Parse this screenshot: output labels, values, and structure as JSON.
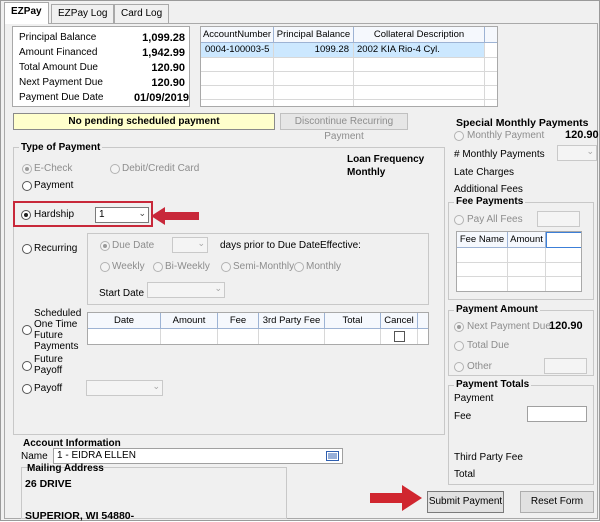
{
  "tabs": [
    {
      "label": "EZPay",
      "active": true
    },
    {
      "label": "EZPay Log",
      "active": false
    },
    {
      "label": "Card Log",
      "active": false
    }
  ],
  "summary": {
    "principal_balance_label": "Principal Balance",
    "principal_balance": "1,099.28",
    "amount_financed_label": "Amount Financed",
    "amount_financed": "1,942.99",
    "total_amount_due_label": "Total Amount Due",
    "total_amount_due": "120.90",
    "next_payment_due_label": "Next Payment Due",
    "next_payment_due": "120.90",
    "payment_due_date_label": "Payment Due Date",
    "payment_due_date": "01/09/2019"
  },
  "accounts_grid": {
    "headers": [
      "AccountNumber",
      "Principal Balance",
      "Collateral Description"
    ],
    "rows": [
      [
        "0004-100003-5",
        "1099.28",
        "2002 KIA Rio-4 Cyl."
      ]
    ]
  },
  "banner": "No pending scheduled payment",
  "discontinue_button": "Discontinue Recurring Payment",
  "type_of_payment": {
    "title": "Type of Payment",
    "echeck": "E-Check",
    "debit_credit": "Debit/Credit Card",
    "payment": "Payment",
    "hardship": "Hardship",
    "hardship_value": "1",
    "recurring": "Recurring",
    "scheduled": [
      "Scheduled",
      "One Time",
      "Future",
      "Payments"
    ],
    "future_payoff": [
      "Future",
      "Payoff"
    ],
    "payoff": "Payoff"
  },
  "loan_frequency": {
    "label": "Loan Frequency",
    "value": "Monthly"
  },
  "recurring": {
    "due_date": "Due Date",
    "days_prior": "days prior to Due Date",
    "effective": "Effective:",
    "weekly": "Weekly",
    "biweekly": "Bi-Weekly",
    "semimonthly": "Semi-Monthly",
    "monthly": "Monthly",
    "start_date": "Start Date"
  },
  "scheduled_grid": {
    "headers": [
      "Date",
      "Amount",
      "Fee",
      "3rd Party Fee",
      "Total",
      "Cancel"
    ]
  },
  "special_monthly": {
    "title": "Special Monthly Payments",
    "monthly_payment": "Monthly Payment",
    "monthly_payment_value": "120.90",
    "num_monthly": "# Monthly Payments",
    "late_charges": "Late Charges",
    "additional_fees": "Additional Fees"
  },
  "fee_payments": {
    "title": "Fee Payments",
    "pay_all_fees": "Pay All Fees",
    "headers": [
      "Fee Name",
      "Amount"
    ]
  },
  "payment_amount": {
    "title": "Payment Amount",
    "next_payment_due": "Next Payment Due",
    "next_payment_due_value": "120.90",
    "total_due": "Total Due",
    "other": "Other"
  },
  "payment_totals": {
    "title": "Payment Totals",
    "payment": "Payment",
    "fee": "Fee",
    "third_party_fee": "Third Party Fee",
    "total": "Total"
  },
  "account_info": {
    "title": "Account Information",
    "name_label": "Name",
    "name_value": "1 - EIDRA ELLEN",
    "mailing_title": "Mailing Address",
    "address_line1": "26 DRIVE",
    "address_line2": "SUPERIOR, WI  54880-"
  },
  "buttons": {
    "submit": "Submit Payment",
    "reset": "Reset Form"
  },
  "colors": {
    "highlight_red": "#c8283a",
    "banner_yellow": "#ffffcc",
    "grid_selected": "#cce8ff"
  }
}
